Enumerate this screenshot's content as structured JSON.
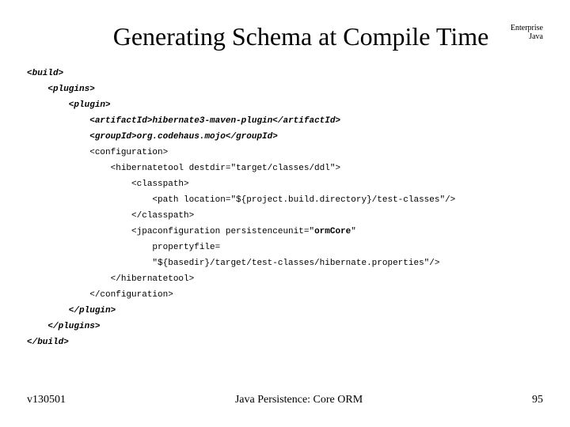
{
  "header": {
    "title": "Generating Schema at Compile Time",
    "corner_line1": "Enterprise",
    "corner_line2": "Java"
  },
  "code": {
    "l01": "<build>",
    "l02": "    <plugins>",
    "l03": "        <plugin>",
    "l04a": "            <artifactId>",
    "l04b": "hibernate3-maven-plugin",
    "l04c": "</artifactId>",
    "l05a": "            <groupId>",
    "l05b": "org.codehaus.mojo",
    "l05c": "</groupId>",
    "l06": "            <configuration>",
    "l07": "                <hibernatetool destdir=\"target/classes/ddl\">",
    "l08": "                    <classpath>",
    "l09": "                        <path location=\"${project.build.directory}/test-classes\"/>",
    "l10": "                    </classpath>",
    "l11a": "                    <jpaconfiguration persistenceunit=\"",
    "l11b": "ormCore",
    "l11c": "\"",
    "l12": "                        propertyfile=",
    "l13": "                        \"${basedir}/target/test-classes/hibernate.properties\"/>",
    "l14": "                </hibernatetool>",
    "l15": "            </configuration>",
    "l16": "        </plugin>",
    "l17": "    </plugins>",
    "l18": "</build>"
  },
  "footer": {
    "version": "v130501",
    "center": "Java Persistence: Core ORM",
    "page": "95"
  }
}
